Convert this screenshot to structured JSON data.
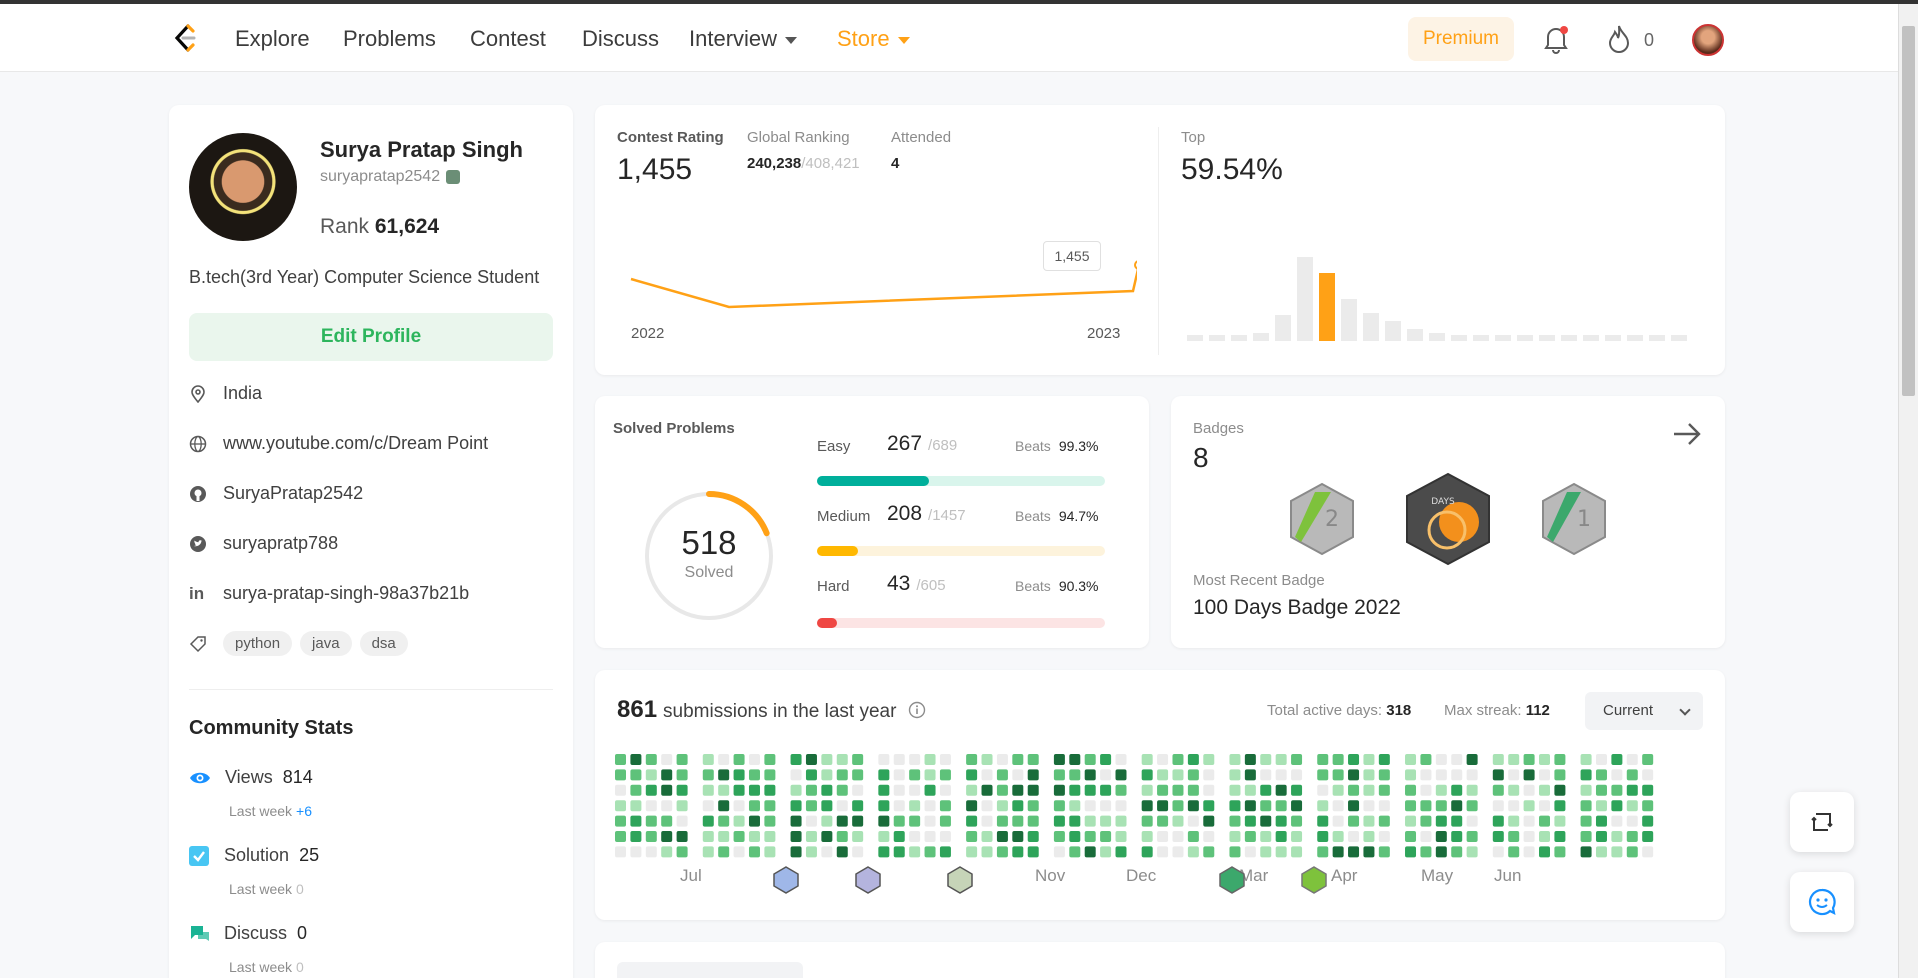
{
  "nav": {
    "links": [
      "Explore",
      "Problems",
      "Contest",
      "Discuss"
    ],
    "interview": "Interview",
    "store": "Store",
    "premium": "Premium",
    "fire_count": "0"
  },
  "profile": {
    "name": "Surya Pratap Singh",
    "handle": "suryapratap2542",
    "rank_label": "Rank",
    "rank_value": "61,624",
    "bio": "B.tech(3rd Year) Computer Science Student",
    "edit_label": "Edit Profile",
    "location": "India",
    "website": "www.youtube.com/c/Dream Point",
    "github": "SuryaPratap2542",
    "twitter": "suryapratp788",
    "linkedin": "surya-pratap-singh-98a37b21b",
    "tags": [
      "python",
      "java",
      "dsa"
    ]
  },
  "community": {
    "title": "Community Stats",
    "views_label": "Views",
    "views_value": "814",
    "views_week_label": "Last week",
    "views_week": "+6",
    "solution_label": "Solution",
    "solution_value": "25",
    "solution_week_label": "Last week",
    "solution_week": "0",
    "discuss_label": "Discuss",
    "discuss_value": "0",
    "discuss_week_label": "Last week",
    "discuss_week": "0"
  },
  "contest": {
    "rating_label": "Contest Rating",
    "rating": "1,455",
    "global_label": "Global Ranking",
    "global_rank": "240,238",
    "global_total": "/408,421",
    "attended_label": "Attended",
    "attended": "4",
    "top_label": "Top",
    "top_value": "59.54%",
    "year_start": "2022",
    "year_end": "2023",
    "tooltip": "1,455"
  },
  "solved": {
    "title": "Solved Problems",
    "total": "518",
    "total_label": "Solved",
    "easy_label": "Easy",
    "easy": "267",
    "easy_total": "/689",
    "easy_beats": "99.3%",
    "medium_label": "Medium",
    "medium": "208",
    "medium_total": "/1457",
    "medium_beats": "94.7%",
    "hard_label": "Hard",
    "hard": "43",
    "hard_total": "/605",
    "hard_beats": "90.3%",
    "beats_label": "Beats",
    "easy_fraction": 0.388,
    "medium_fraction": 0.143,
    "hard_fraction": 0.071,
    "ring_fraction": 0.19,
    "colors": {
      "easy": "#00af9b",
      "medium": "#ffb800",
      "hard": "#ef4743"
    }
  },
  "badges": {
    "label": "Badges",
    "count": "8",
    "recent_label": "Most Recent Badge",
    "recent": "100 Days Badge 2022"
  },
  "submissions": {
    "count": "861",
    "text": "submissions in the last year",
    "active_label": "Total active days:",
    "active": "318",
    "streak_label": "Max streak:",
    "streak": "112",
    "current": "Current",
    "months": [
      "Jul",
      "Nov",
      "Dec",
      "Mar",
      "Apr",
      "May",
      "Jun"
    ]
  }
}
